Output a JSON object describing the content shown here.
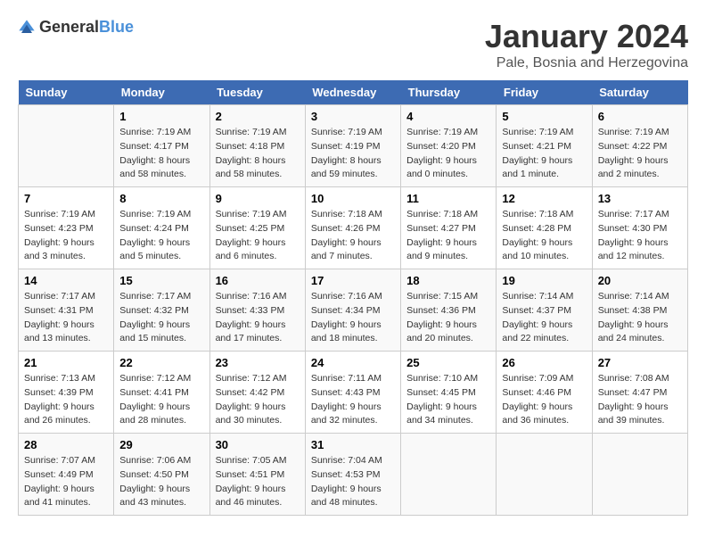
{
  "header": {
    "logo_general": "General",
    "logo_blue": "Blue",
    "month_title": "January 2024",
    "location": "Pale, Bosnia and Herzegovina"
  },
  "days_of_week": [
    "Sunday",
    "Monday",
    "Tuesday",
    "Wednesday",
    "Thursday",
    "Friday",
    "Saturday"
  ],
  "weeks": [
    [
      {
        "day": "",
        "info": ""
      },
      {
        "day": "1",
        "info": "Sunrise: 7:19 AM\nSunset: 4:17 PM\nDaylight: 8 hours\nand 58 minutes."
      },
      {
        "day": "2",
        "info": "Sunrise: 7:19 AM\nSunset: 4:18 PM\nDaylight: 8 hours\nand 58 minutes."
      },
      {
        "day": "3",
        "info": "Sunrise: 7:19 AM\nSunset: 4:19 PM\nDaylight: 8 hours\nand 59 minutes."
      },
      {
        "day": "4",
        "info": "Sunrise: 7:19 AM\nSunset: 4:20 PM\nDaylight: 9 hours\nand 0 minutes."
      },
      {
        "day": "5",
        "info": "Sunrise: 7:19 AM\nSunset: 4:21 PM\nDaylight: 9 hours\nand 1 minute."
      },
      {
        "day": "6",
        "info": "Sunrise: 7:19 AM\nSunset: 4:22 PM\nDaylight: 9 hours\nand 2 minutes."
      }
    ],
    [
      {
        "day": "7",
        "info": "Sunrise: 7:19 AM\nSunset: 4:23 PM\nDaylight: 9 hours\nand 3 minutes."
      },
      {
        "day": "8",
        "info": "Sunrise: 7:19 AM\nSunset: 4:24 PM\nDaylight: 9 hours\nand 5 minutes."
      },
      {
        "day": "9",
        "info": "Sunrise: 7:19 AM\nSunset: 4:25 PM\nDaylight: 9 hours\nand 6 minutes."
      },
      {
        "day": "10",
        "info": "Sunrise: 7:18 AM\nSunset: 4:26 PM\nDaylight: 9 hours\nand 7 minutes."
      },
      {
        "day": "11",
        "info": "Sunrise: 7:18 AM\nSunset: 4:27 PM\nDaylight: 9 hours\nand 9 minutes."
      },
      {
        "day": "12",
        "info": "Sunrise: 7:18 AM\nSunset: 4:28 PM\nDaylight: 9 hours\nand 10 minutes."
      },
      {
        "day": "13",
        "info": "Sunrise: 7:17 AM\nSunset: 4:30 PM\nDaylight: 9 hours\nand 12 minutes."
      }
    ],
    [
      {
        "day": "14",
        "info": "Sunrise: 7:17 AM\nSunset: 4:31 PM\nDaylight: 9 hours\nand 13 minutes."
      },
      {
        "day": "15",
        "info": "Sunrise: 7:17 AM\nSunset: 4:32 PM\nDaylight: 9 hours\nand 15 minutes."
      },
      {
        "day": "16",
        "info": "Sunrise: 7:16 AM\nSunset: 4:33 PM\nDaylight: 9 hours\nand 17 minutes."
      },
      {
        "day": "17",
        "info": "Sunrise: 7:16 AM\nSunset: 4:34 PM\nDaylight: 9 hours\nand 18 minutes."
      },
      {
        "day": "18",
        "info": "Sunrise: 7:15 AM\nSunset: 4:36 PM\nDaylight: 9 hours\nand 20 minutes."
      },
      {
        "day": "19",
        "info": "Sunrise: 7:14 AM\nSunset: 4:37 PM\nDaylight: 9 hours\nand 22 minutes."
      },
      {
        "day": "20",
        "info": "Sunrise: 7:14 AM\nSunset: 4:38 PM\nDaylight: 9 hours\nand 24 minutes."
      }
    ],
    [
      {
        "day": "21",
        "info": "Sunrise: 7:13 AM\nSunset: 4:39 PM\nDaylight: 9 hours\nand 26 minutes."
      },
      {
        "day": "22",
        "info": "Sunrise: 7:12 AM\nSunset: 4:41 PM\nDaylight: 9 hours\nand 28 minutes."
      },
      {
        "day": "23",
        "info": "Sunrise: 7:12 AM\nSunset: 4:42 PM\nDaylight: 9 hours\nand 30 minutes."
      },
      {
        "day": "24",
        "info": "Sunrise: 7:11 AM\nSunset: 4:43 PM\nDaylight: 9 hours\nand 32 minutes."
      },
      {
        "day": "25",
        "info": "Sunrise: 7:10 AM\nSunset: 4:45 PM\nDaylight: 9 hours\nand 34 minutes."
      },
      {
        "day": "26",
        "info": "Sunrise: 7:09 AM\nSunset: 4:46 PM\nDaylight: 9 hours\nand 36 minutes."
      },
      {
        "day": "27",
        "info": "Sunrise: 7:08 AM\nSunset: 4:47 PM\nDaylight: 9 hours\nand 39 minutes."
      }
    ],
    [
      {
        "day": "28",
        "info": "Sunrise: 7:07 AM\nSunset: 4:49 PM\nDaylight: 9 hours\nand 41 minutes."
      },
      {
        "day": "29",
        "info": "Sunrise: 7:06 AM\nSunset: 4:50 PM\nDaylight: 9 hours\nand 43 minutes."
      },
      {
        "day": "30",
        "info": "Sunrise: 7:05 AM\nSunset: 4:51 PM\nDaylight: 9 hours\nand 46 minutes."
      },
      {
        "day": "31",
        "info": "Sunrise: 7:04 AM\nSunset: 4:53 PM\nDaylight: 9 hours\nand 48 minutes."
      },
      {
        "day": "",
        "info": ""
      },
      {
        "day": "",
        "info": ""
      },
      {
        "day": "",
        "info": ""
      }
    ]
  ]
}
